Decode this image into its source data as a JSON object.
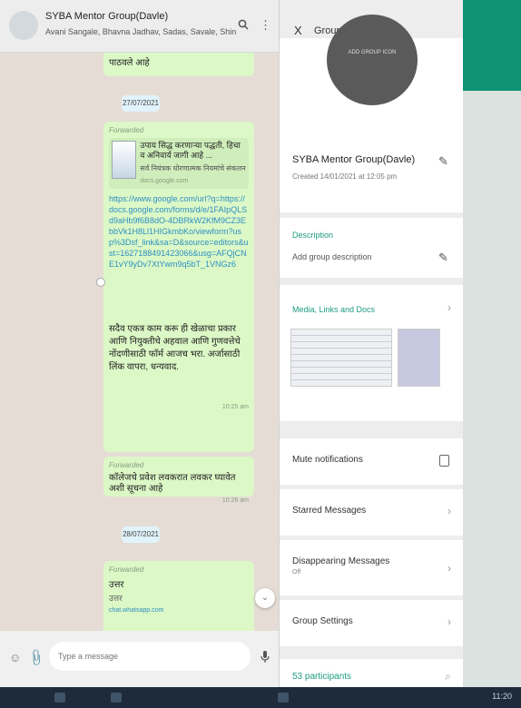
{
  "chat": {
    "title": "SYBA Mentor Group(Davle)",
    "subtitle": "Avani Sangale, Bhavna Jadhav, Sadas, Savale, Shinde, Shirke, Ra...",
    "icons": {
      "search": "search-icon",
      "menu": "more-vert-icon"
    },
    "top_text": "पाठवले आहे",
    "date1": "27/07/2021",
    "date2": "28/07/2021",
    "forwarded_label": "Forwarded",
    "msg1": {
      "preview_title": "उपाय सिद्ध करणाऱ्या पद्धती, हिचा व अनिवार्य जागी आहे ...",
      "preview_desc": "सर्व नियंत्रक धोरणात्मक नियमांचे संकलन",
      "preview_domain": "docs.google.com",
      "link": "https://www.google.com/url?q=https://docs.google.com/forms/d/e/1FAIpQLSd9aHb9f6B8dO-4DBRkW2KfM9CZ3EbbVk1H8Ll1HIGkmbKo/viewform?usp%3Dsf_link&sa=D&source=editors&ust=1627188491423066&usg=AFQjCNE1vY9yDv7XtYwm9q5bT_1VNGz6",
      "text": "सदैव एकत्र काम करू ही खेळाचा प्रकार आणि नियुक्तीचे अहवाल आणि गुणवत्तेचे नोंदणीसाठी फॉर्म आजच भरा. अर्जासाठी लिंक वापरा, धन्यवाद.",
      "time": "10:25 am"
    },
    "msg2": {
      "text": "कॉलेजचे प्रवेश लवकरात लवकर घ्यावेत अशी सूचना आहे",
      "time": "10:26 am"
    },
    "msg3": {
      "line1": "उत्तर",
      "line2": "उत्तर",
      "link": "chat.whatsapp.com"
    },
    "composer_placeholder": "Type a message",
    "composer_icons": {
      "emoji": "emoji-icon",
      "attach": "paperclip-icon",
      "mic": "mic-icon"
    }
  },
  "info": {
    "close": "X",
    "title": "Group info",
    "icon_text": "ADD GROUP ICON",
    "group_name": "SYBA Mentor Group(Davle)",
    "created": "Created 14/01/2021 at 12:05 pm",
    "description_label": "Description",
    "description_value": "Add group description",
    "media_label": "Media, Links and Docs",
    "rows": [
      {
        "label": "Mute notifications",
        "sub": ""
      },
      {
        "label": "Starred Messages",
        "sub": ""
      },
      {
        "label": "Disappearing Messages",
        "sub": "Off"
      },
      {
        "label": "Group Settings",
        "sub": ""
      },
      {
        "label": "53 participants",
        "sub": ""
      }
    ]
  },
  "taskbar": {
    "clock": "11:20"
  },
  "colors": {
    "accent": "#0e9474",
    "bubble": "#dcf8c6",
    "label": "#1d9b7f",
    "chat_bg": "#e5ddd5"
  }
}
